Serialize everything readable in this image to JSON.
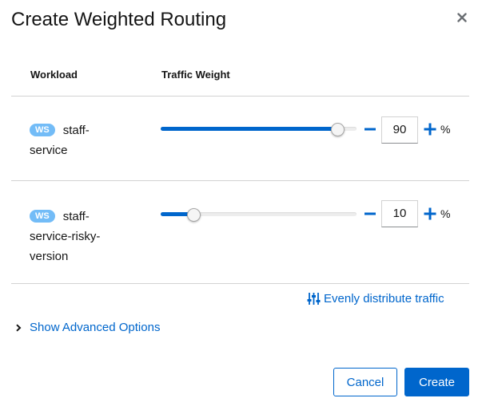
{
  "dialog": {
    "title": "Create Weighted Routing",
    "close_icon": "close-icon"
  },
  "table": {
    "headers": [
      "Workload",
      "Traffic Weight"
    ],
    "rows": [
      {
        "badge": "WS",
        "name_lines": [
          "staff-",
          "service"
        ],
        "weight": 90,
        "weight_text": "90",
        "unit": "%"
      },
      {
        "badge": "WS",
        "name_lines": [
          "staff-",
          "service-risky-",
          "version"
        ],
        "weight": 10,
        "weight_text": "10",
        "unit": "%"
      }
    ]
  },
  "actions": {
    "evenly_distribute": "Evenly distribute traffic",
    "show_advanced": "Show Advanced Options",
    "cancel": "Cancel",
    "create": "Create"
  },
  "colors": {
    "accent": "#0066cc",
    "badge": "#73bcf7",
    "divider": "#d2d2d2"
  }
}
